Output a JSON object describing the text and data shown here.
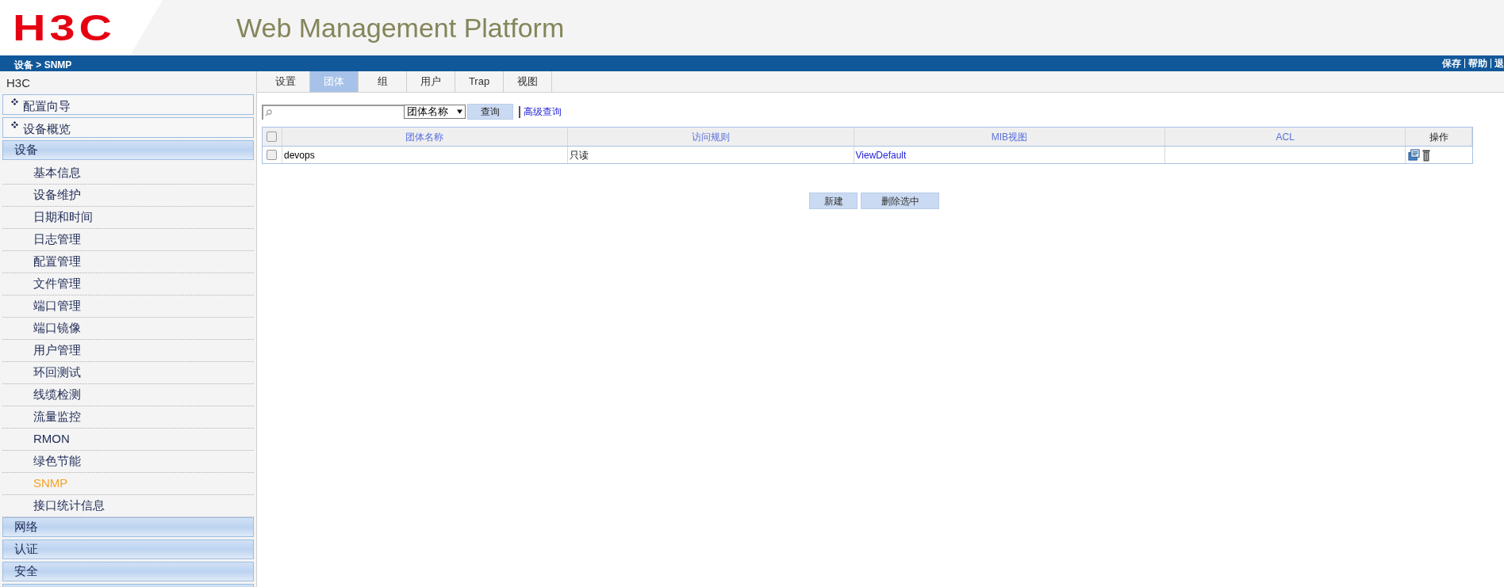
{
  "header": {
    "logo": "H3C",
    "title": "Web Management Platform"
  },
  "top_bar": {
    "breadcrumb": "设备 > SNMP",
    "links": [
      "保存",
      "帮助",
      "退"
    ]
  },
  "sidebar": {
    "root": "H3C",
    "quick_items": [
      {
        "label": "配置向导"
      },
      {
        "label": "设备概览"
      }
    ],
    "groups": [
      {
        "label": "设备",
        "children": [
          {
            "label": "基本信息",
            "selected": false
          },
          {
            "label": "设备维护",
            "selected": false
          },
          {
            "label": "日期和时间",
            "selected": false
          },
          {
            "label": "日志管理",
            "selected": false
          },
          {
            "label": "配置管理",
            "selected": false
          },
          {
            "label": "文件管理",
            "selected": false
          },
          {
            "label": "端口管理",
            "selected": false
          },
          {
            "label": "端口镜像",
            "selected": false
          },
          {
            "label": "用户管理",
            "selected": false
          },
          {
            "label": "环回测试",
            "selected": false
          },
          {
            "label": "线缆检测",
            "selected": false
          },
          {
            "label": "流量监控",
            "selected": false
          },
          {
            "label": "RMON",
            "selected": false
          },
          {
            "label": "绿色节能",
            "selected": false
          },
          {
            "label": "SNMP",
            "selected": true
          },
          {
            "label": "接口统计信息",
            "selected": false
          }
        ]
      },
      {
        "label": "网络"
      },
      {
        "label": "认证"
      },
      {
        "label": "安全"
      }
    ]
  },
  "tabs": [
    {
      "label": "设置",
      "selected": false
    },
    {
      "label": "团体",
      "selected": true
    },
    {
      "label": "组",
      "selected": false
    },
    {
      "label": "用户",
      "selected": false
    },
    {
      "label": "Trap",
      "selected": false
    },
    {
      "label": "视图",
      "selected": false
    }
  ],
  "search": {
    "field_select": "团体名称",
    "query_button": "查询",
    "advanced_link": "高级查询"
  },
  "table": {
    "all_checked": false,
    "columns": [
      "团体名称",
      "访问规则",
      "MIB视图",
      "ACL",
      "操作"
    ],
    "rows": [
      {
        "checked": false,
        "name": "devops",
        "access": "只读",
        "mib_view": "ViewDefault",
        "acl": ""
      }
    ]
  },
  "buttons": [
    "新建",
    "删除选中"
  ]
}
